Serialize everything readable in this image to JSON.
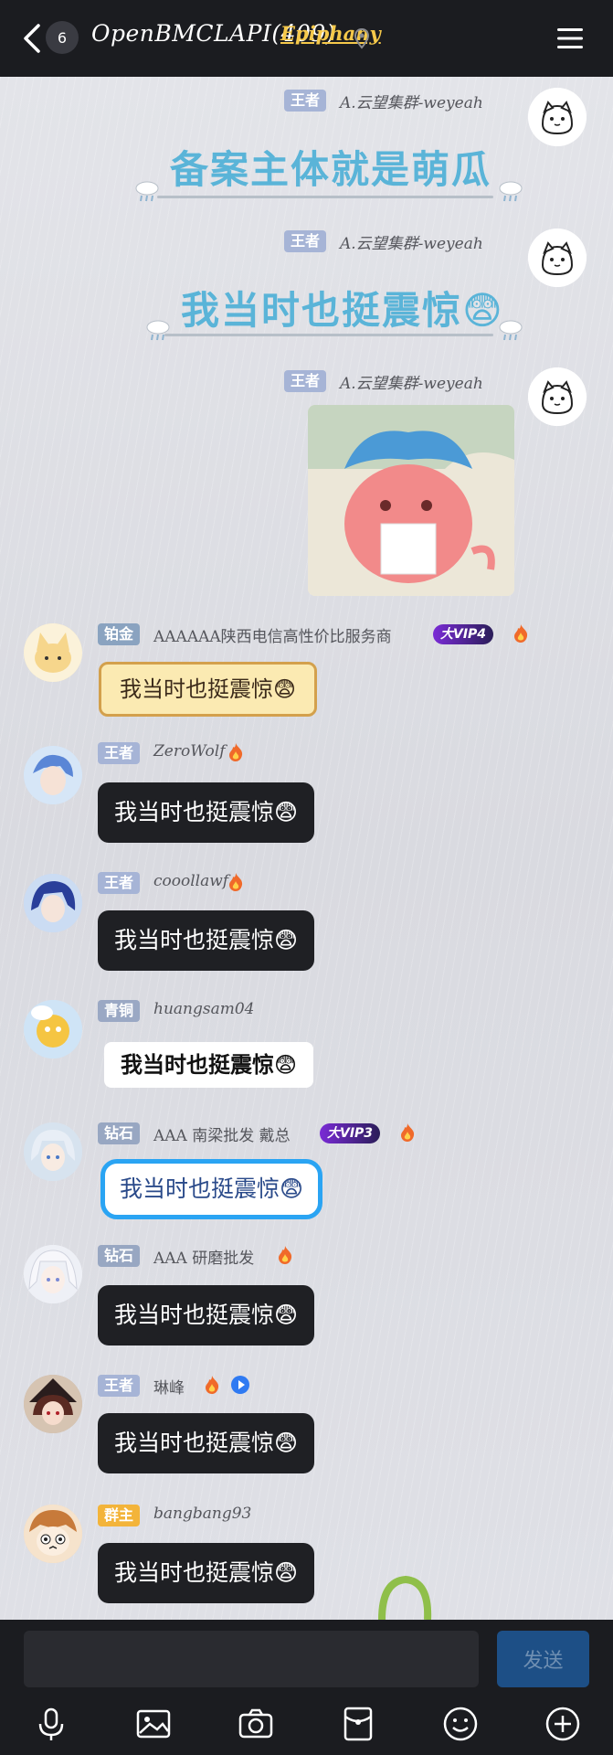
{
  "header": {
    "unread_count": "6",
    "title": "OpenBMCLAPI(409)",
    "title_tag": "Epiphany"
  },
  "messages": [
    {
      "badge": "王者",
      "name": "A.云望集群-weyeah",
      "text": "备案主体就是萌瓜"
    },
    {
      "badge": "王者",
      "name": "A.云望集群-weyeah",
      "text": "我当时也挺震惊😨"
    },
    {
      "badge": "王者",
      "name": "A.云望集群-weyeah"
    },
    {
      "badge": "铂金",
      "name": "AAAAAA陕西电信高性价比服务商",
      "vip": "大VIP4",
      "text": "我当时也挺震惊😨"
    },
    {
      "badge": "王者",
      "name": "ZeroWolf",
      "text": "我当时也挺震惊😨"
    },
    {
      "badge": "王者",
      "name": "cooollawf",
      "text": "我当时也挺震惊😨"
    },
    {
      "badge": "青铜",
      "name": "huangsam04",
      "text": "我当时也挺震惊😨"
    },
    {
      "badge": "钻石",
      "name": "AAA 南梁批发 戴总",
      "vip": "大VIP3",
      "text": "我当时也挺震惊😨"
    },
    {
      "badge": "钻石",
      "name": "AAA 研磨批发",
      "text": "我当时也挺震惊😨"
    },
    {
      "badge": "王者",
      "name": "琳峰",
      "text": "我当时也挺震惊😨"
    },
    {
      "badge": "群主",
      "name": "bangbang93",
      "text": "我当时也挺震惊😨"
    }
  ],
  "colors": {
    "badge_king": "#a6b4d6",
    "badge_platinum": "#8aa3c0",
    "badge_bronze": "#9aa8c4",
    "badge_diamond": "#98a7c2",
    "badge_owner": "#f3b43a"
  },
  "input": {
    "placeholder": "",
    "send_label": "发送"
  },
  "toolbar": [
    "mic-icon",
    "image-icon",
    "camera-icon",
    "red-packet-icon",
    "emoji-icon",
    "plus-icon"
  ]
}
